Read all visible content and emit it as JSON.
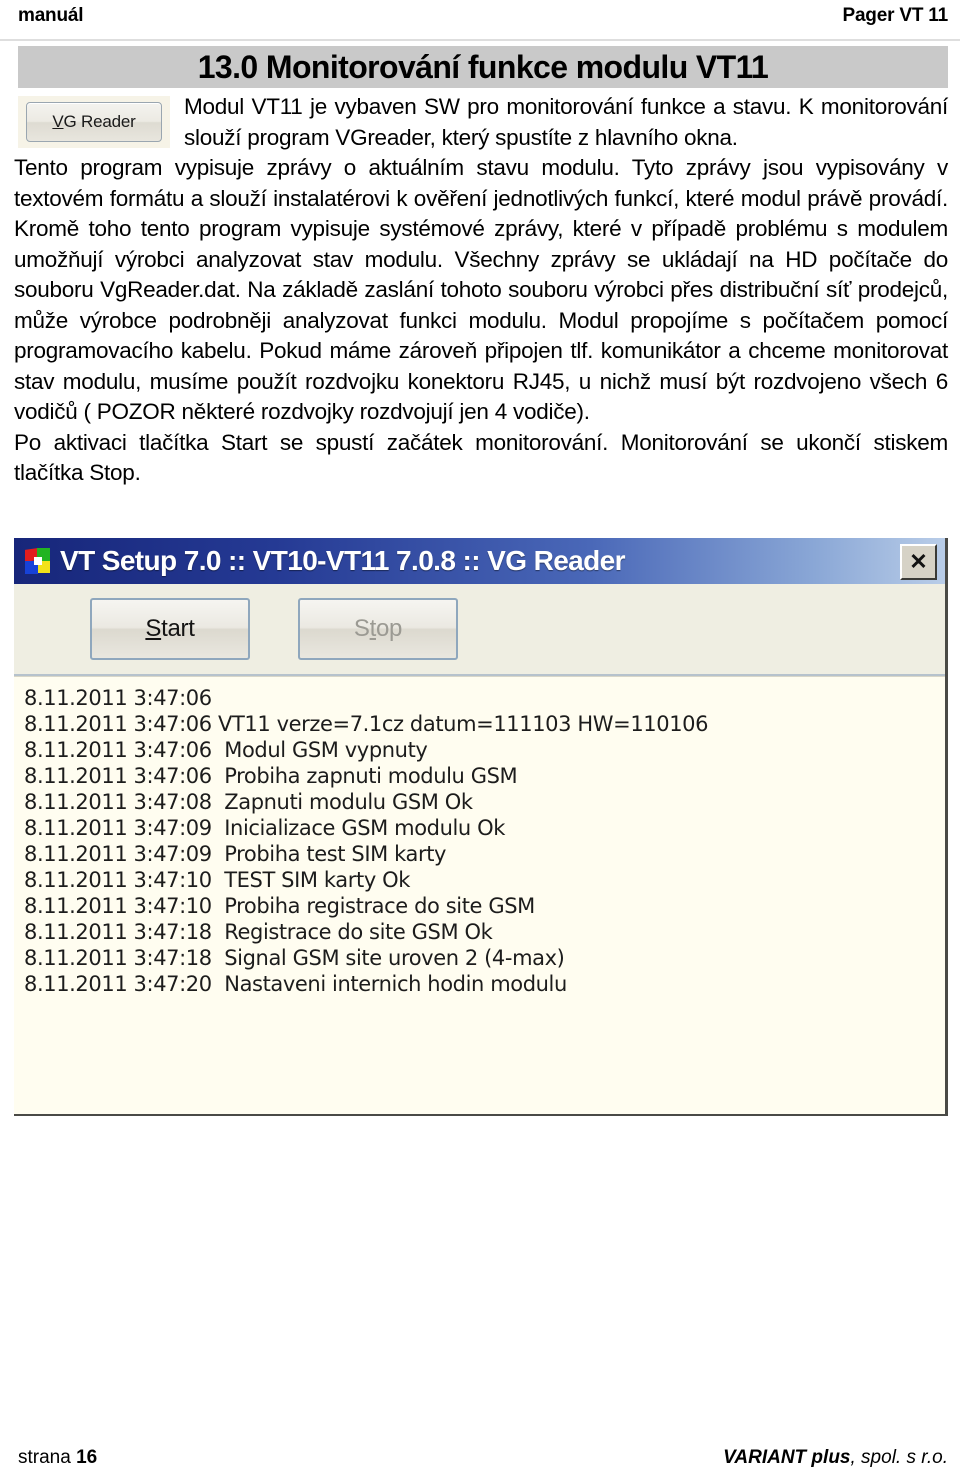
{
  "header": {
    "left": "manuál",
    "right": "Pager VT 11"
  },
  "chapter": {
    "title": "13.0 Monitorování funkce modulu VT11"
  },
  "figure": {
    "vg_reader_button_label_underlined": "V",
    "vg_reader_button_label_rest": "G Reader"
  },
  "body": {
    "paragraph_1": "Modul VT11 je vybaven SW pro monitorování funkce a stavu. K monitorování slouží program VGreader, který spustíte z hlavního okna.",
    "paragraph_2": "Tento program vypisuje zprávy o aktuálním stavu modulu. Tyto zprávy jsou vypisovány v textovém formátu a slouží instalatérovi k ověření jednotlivých funkcí, které modul právě provádí. Kromě toho tento program vypisuje systémové zprávy, které v případě problému s modulem umožňují výrobci analyzovat stav modulu. Všechny zprávy se ukládají na HD počítače do souboru VgReader.dat. Na  základě zaslání tohoto souboru výrobci přes distribuční síť prodejců, může výrobce podrobněji analyzovat funkci modulu. Modul propojíme  s počítačem pomocí programovacího kabelu. Pokud máme zároveň připojen tlf. komunikátor a chceme monitorovat stav modulu, musíme použít rozdvojku konektoru RJ45, u nichž musí být rozdvojeno všech 6 vodičů ( POZOR některé rozdvojky rozdvojují jen 4 vodiče).",
    "paragraph_3": "Po aktivaci tlačítka Start se spustí začátek monitorování. Monitorování se ukončí stiskem tlačítka Stop."
  },
  "app_window": {
    "icon_name": "vt-setup-app-icon",
    "title": "VT Setup 7.0 :: VT10-VT11 7.0.8 :: VG Reader",
    "close_label": "✕",
    "buttons": [
      {
        "name": "start-button",
        "prefix": "",
        "underlined": "S",
        "suffix": "tart",
        "state": "enabled"
      },
      {
        "name": "stop-button",
        "prefix": "S",
        "underlined": "t",
        "suffix": "op",
        "state": "disabled"
      }
    ],
    "log_lines": [
      "8.11.2011 3:47:06",
      "8.11.2011 3:47:06 VT11 verze=7.1cz datum=111103 HW=110106",
      "8.11.2011 3:47:06  Modul GSM vypnuty",
      "8.11.2011 3:47:06  Probiha zapnuti modulu GSM",
      "8.11.2011 3:47:08  Zapnuti modulu GSM Ok",
      "8.11.2011 3:47:09  Inicializace GSM modulu Ok",
      "8.11.2011 3:47:09  Probiha test SIM karty",
      "8.11.2011 3:47:10  TEST SIM karty Ok",
      "8.11.2011 3:47:10  Probiha registrace do site GSM",
      "8.11.2011 3:47:18  Registrace do site GSM Ok",
      "8.11.2011 3:47:18  Signal GSM site uroven 2 (4-max)",
      "8.11.2011 3:47:20  Nastaveni internich hodin modulu"
    ]
  },
  "footer": {
    "left_label": "strana ",
    "page_number": "16",
    "right_brand": "VARIANT plus",
    "right_suffix": ", spol. s r.o."
  },
  "colors": {
    "banner_gray": "#c9c9c9",
    "titlebar_blue": "#17267a",
    "log_background": "#fffdf0",
    "toolbar_background": "#efeee2"
  }
}
